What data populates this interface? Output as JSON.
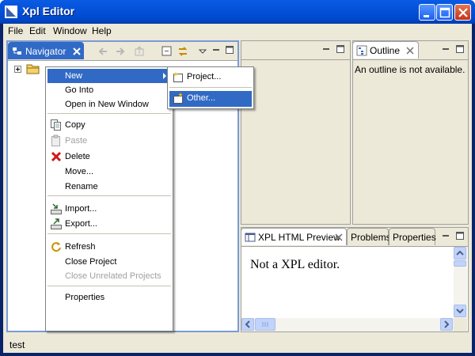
{
  "window": {
    "title": "Xpl Editor"
  },
  "menubar": {
    "items": [
      "File",
      "Edit",
      "Window",
      "Help"
    ]
  },
  "navigator": {
    "tab_label": "Navigator"
  },
  "outline": {
    "tab_label": "Outline",
    "message": "An outline is not available."
  },
  "preview": {
    "tabs": [
      "XPL HTML Preview",
      "Problems",
      "Properties"
    ],
    "message": "Not a XPL editor."
  },
  "context_menu": {
    "items": [
      {
        "label": "New",
        "icon": "none",
        "submenu": true
      },
      {
        "label": "Go Into",
        "icon": "none"
      },
      {
        "label": "Open in New Window",
        "icon": "none"
      },
      {
        "label": "Copy",
        "icon": "copy-icon"
      },
      {
        "label": "Paste",
        "icon": "paste-icon",
        "disabled": true
      },
      {
        "label": "Delete",
        "icon": "delete-icon"
      },
      {
        "label": "Move...",
        "icon": "none"
      },
      {
        "label": "Rename",
        "icon": "none"
      },
      {
        "label": "Import...",
        "icon": "import-icon"
      },
      {
        "label": "Export...",
        "icon": "export-icon"
      },
      {
        "label": "Refresh",
        "icon": "refresh-icon"
      },
      {
        "label": "Close Project",
        "icon": "none"
      },
      {
        "label": "Close Unrelated Projects",
        "icon": "none",
        "disabled": true
      },
      {
        "label": "Properties",
        "icon": "none"
      }
    ]
  },
  "submenu": {
    "items": [
      {
        "label": "Project...",
        "icon": "new-project-icon"
      },
      {
        "label": "Other...",
        "icon": "new-other-icon"
      }
    ]
  },
  "status_bar": {
    "text": "test"
  },
  "colors": {
    "selection": "#316ac5",
    "titlebar": "#0350d8",
    "chrome": "#ece9d8"
  }
}
